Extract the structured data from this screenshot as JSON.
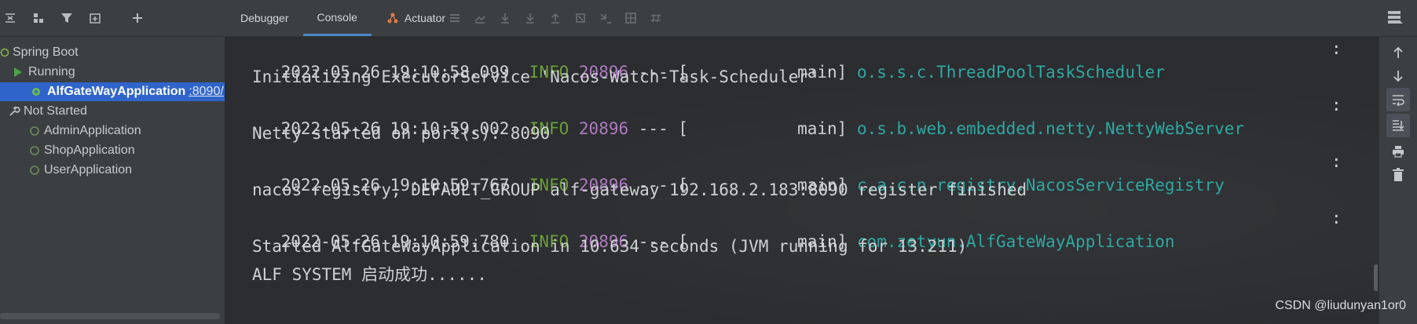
{
  "toolbar": {
    "tabs": [
      {
        "label": "Debugger",
        "active": false
      },
      {
        "label": "Console",
        "active": true
      },
      {
        "label": "Actuator",
        "active": false
      }
    ]
  },
  "sidebar": {
    "root": "Spring Boot",
    "running_label": "Running",
    "selected_app": "AlfGateWayApplication",
    "selected_port": ":8090/",
    "not_started_label": "Not Started",
    "not_started_apps": [
      "AdminApplication",
      "ShopApplication",
      "UserApplication"
    ]
  },
  "console": {
    "entries": [
      {
        "timestamp": "2022-05-26 19:10:58.099",
        "level": "INFO",
        "pid": "20896",
        "sep": "--- [",
        "thread": "main]",
        "logger": "o.s.s.c.ThreadPoolTaskScheduler",
        "colon": ":",
        "message": "Initializing ExecutorService 'Nacos-Watch-Task-Scheduler'"
      },
      {
        "timestamp": "2022-05-26 19:10:59.002",
        "level": "INFO",
        "pid": "20896",
        "sep": "--- [",
        "thread": "main]",
        "logger": "o.s.b.web.embedded.netty.NettyWebServer",
        "colon": ":",
        "message": "Netty started on port(s): 8090"
      },
      {
        "timestamp": "2022-05-26 19:10:59.767",
        "level": "INFO",
        "pid": "20896",
        "sep": "--- [",
        "thread": "main]",
        "logger": "c.a.c.n.registry.NacosServiceRegistry",
        "colon": ":",
        "message": "nacos registry, DEFAULT_GROUP alf-gateway 192.168.2.183:8090 register finished"
      },
      {
        "timestamp": "2022-05-26 19:10:59.780",
        "level": "INFO",
        "pid": "20896",
        "sep": "--- [",
        "thread": "main]",
        "logger": "com.zetyun.AlfGateWayApplication",
        "colon": ":",
        "message": "Started AlfGateWayApplication in 10.634 seconds (JVM running for 13.211)"
      }
    ],
    "final_line": "ALF SYSTEM 启动成功......"
  },
  "watermark": "CSDN @liudunyan1or0",
  "colors": {
    "info": "#6a9f3a",
    "pid": "#b07ac0",
    "logger": "#2fa7a2",
    "selection": "#2f65ca"
  }
}
